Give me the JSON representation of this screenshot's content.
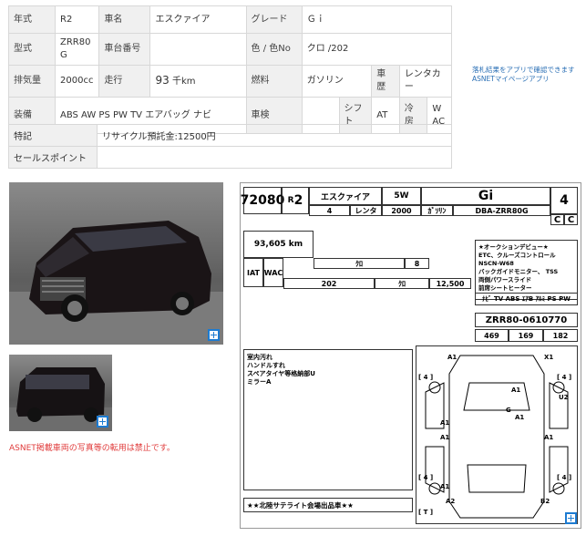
{
  "spec": {
    "year_label": "年式",
    "year": "R2",
    "model_label": "車名",
    "model": "エスクァイア",
    "grade_label": "グレード",
    "grade": "Ｇｉ",
    "type_label": "型式",
    "type": "ZRR80G",
    "chassis_label": "車台番号",
    "chassis": "",
    "color_label": "色 / 色No",
    "color": "クロ /202",
    "displacement_label": "排気量",
    "displacement": "2000cc",
    "mileage_label": "走行",
    "mileage_num": "93",
    "mileage_unit": "千km",
    "fuel_label": "燃料",
    "fuel": "ガソリン",
    "inspection_type_label": "車歴",
    "inspection_type": "レンタカー",
    "equipment_label": "装備",
    "equipment": "ABS AW PS PW TV エアバッグ ナビ",
    "shaken_label": "車検",
    "shaken": "",
    "shift_label": "シフト",
    "shift": "AT",
    "ac_label": "冷房",
    "ac": "WAC"
  },
  "notes": {
    "special_label": "特記",
    "special": "リサイクル預託金:12500円",
    "sales_point_label": "セールスポイント",
    "sales_point": ""
  },
  "asnet_note": {
    "line1": "落札結果をアプリで確認できます",
    "line2": "ASNETマイページアプリ"
  },
  "copy_notice": "ASNET掲載車両の写真等の転用は禁止です。",
  "sheet": {
    "lot": "72080",
    "era": "R",
    "year": "2",
    "model": "エスクァイア",
    "doors": "5W",
    "grade": "Gi",
    "score": "4",
    "month": "4",
    "usage": "レンタ",
    "cc": "2000",
    "fuel": "ｶﾞｿﾘﾝ",
    "type_code": "DBA-ZRR80G",
    "int_grade": "C",
    "ext_grade": "C",
    "mileage": "93,605 km",
    "color": "ｸﾛ",
    "seats": "8",
    "color_no": "202",
    "color2": "ｸﾛ",
    "recycle": "12,500",
    "trans": "IAT",
    "ac": "WAC",
    "sales_points": [
      "★オークションデビュー★",
      "ETC、クルーズコントロール",
      "NSCN-W68",
      "バックガイドモニター、 TSS",
      "両側パワースライド",
      "前席シートヒーター"
    ],
    "equip": "ﾅﾋﾞ TV ABS ｴｱB ｱﾙﾐ PS PW",
    "frame": "ZRR80-0610770",
    "length": "469",
    "height": "169",
    "width": "182",
    "inspector_notes": [
      "室内汚れ",
      "ハンドルすれ",
      "スペアタイヤ等格納部U",
      "ミラーA"
    ],
    "venue_note": "★★北陸サテライト会場出品車★★",
    "marks": [
      "A1",
      "X1",
      "A1",
      "U2",
      "G",
      "A1",
      "A1",
      "A1",
      "A1",
      "A1",
      "A2",
      "B2"
    ],
    "tire_labels": [
      "4",
      "4",
      "4",
      "4",
      "T"
    ]
  }
}
